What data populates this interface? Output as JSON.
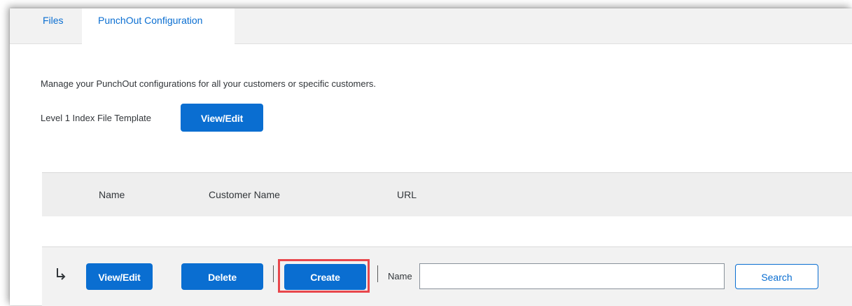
{
  "tabs": [
    {
      "label": "Files",
      "active": false
    },
    {
      "label": "PunchOut Configuration",
      "active": true
    }
  ],
  "description": "Manage your PunchOut configurations for all your customers or specific customers.",
  "level1": {
    "label": "Level 1 Index File Template",
    "button_label": "View/Edit"
  },
  "table": {
    "columns": [
      "Name",
      "Customer Name",
      "URL"
    ],
    "rows": []
  },
  "actions": {
    "view_edit_label": "View/Edit",
    "delete_label": "Delete",
    "create_label": "Create",
    "name_label": "Name",
    "name_value": "",
    "search_label": "Search"
  },
  "icons": {
    "row_action_arrow": "arrow-down-right-icon"
  },
  "colors": {
    "primary": "#0a6ed1",
    "highlight": "#e8474c",
    "header_bg": "#eeeeee",
    "tabbar_bg": "#f2f2f2"
  }
}
